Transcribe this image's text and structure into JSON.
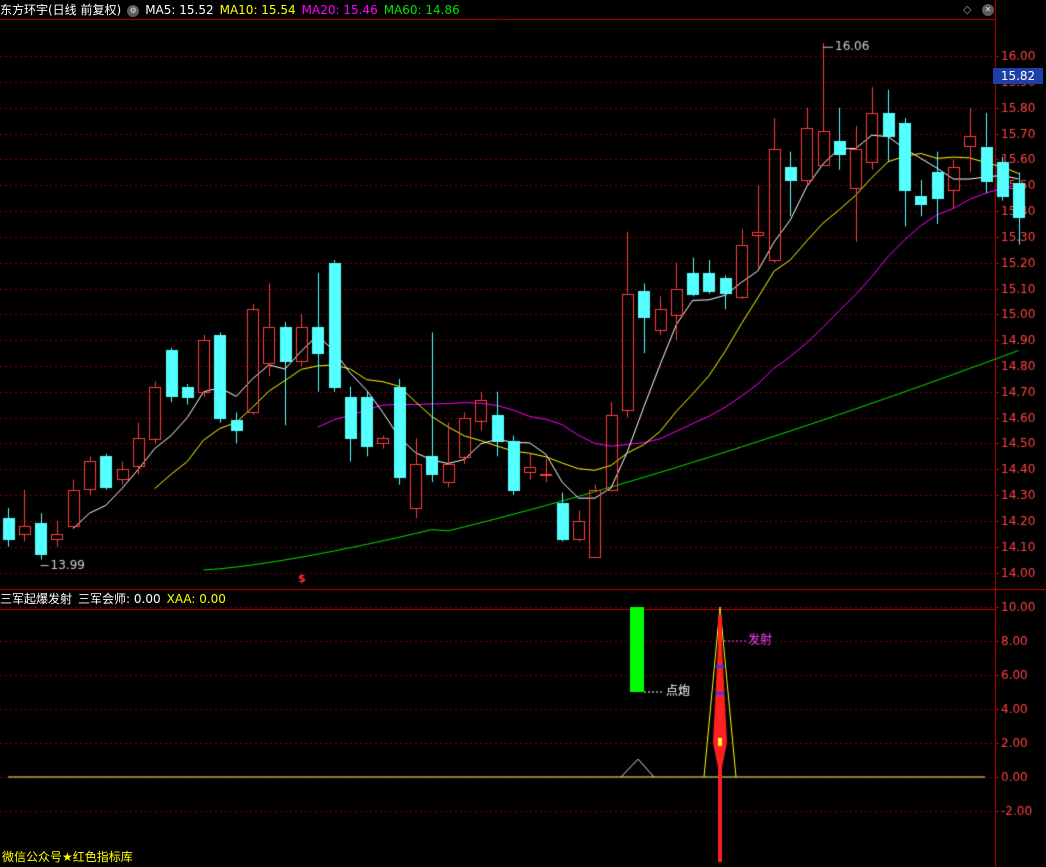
{
  "colors": {
    "up": "#ff3c3c",
    "down": "#54ffff",
    "ma5": "#ffffff",
    "ma10": "#ffff00",
    "ma20": "#ff00ff",
    "ma60": "#00e000",
    "grid": "#7a0000",
    "axis": "#c00000",
    "price_box": "#1e3fa5",
    "footer": "#ffff00"
  },
  "header": {
    "title": "东方环宇(日线 前复权)",
    "ma5_label": "MA5: 15.52",
    "ma10_label": "MA10: 15.54",
    "ma20_label": "MA20: 15.46",
    "ma60_label": "MA60: 14.86"
  },
  "price_panel": {
    "ylim": [
      13.94,
      16.14
    ],
    "ticks": [
      "14.00",
      "14.10",
      "14.20",
      "14.30",
      "14.40",
      "14.50",
      "14.60",
      "14.70",
      "14.80",
      "14.90",
      "15.00",
      "15.10",
      "15.20",
      "15.30",
      "15.40",
      "15.50",
      "15.60",
      "15.70",
      "15.80",
      "15.90",
      "16.00"
    ],
    "current_price": "15.82",
    "high_label": "16.06",
    "low_label": "13.99",
    "marker": "$",
    "candles": [
      [
        14.21,
        14.13,
        14.25,
        14.1
      ],
      [
        14.15,
        14.18,
        14.32,
        14.12
      ],
      [
        14.19,
        14.07,
        14.23,
        14.05
      ],
      [
        14.13,
        14.15,
        14.2,
        14.1
      ],
      [
        14.18,
        14.32,
        14.36,
        14.17
      ],
      [
        14.32,
        14.43,
        14.45,
        14.3
      ],
      [
        14.45,
        14.33,
        14.46,
        14.32
      ],
      [
        14.36,
        14.4,
        14.43,
        14.34
      ],
      [
        14.41,
        14.52,
        14.58,
        14.38
      ],
      [
        14.52,
        14.72,
        14.74,
        14.5
      ],
      [
        14.86,
        14.68,
        14.87,
        14.66
      ],
      [
        14.72,
        14.68,
        14.73,
        14.65
      ],
      [
        14.7,
        14.9,
        14.92,
        14.68
      ],
      [
        14.92,
        14.6,
        14.93,
        14.58
      ],
      [
        14.59,
        14.55,
        14.62,
        14.5
      ],
      [
        14.62,
        15.02,
        15.04,
        14.61
      ],
      [
        14.81,
        14.95,
        15.12,
        14.76
      ],
      [
        14.95,
        14.82,
        14.97,
        14.57
      ],
      [
        14.82,
        14.95,
        15.0,
        14.8
      ],
      [
        14.95,
        14.85,
        15.16,
        14.7
      ],
      [
        15.2,
        14.72,
        15.21,
        14.7
      ],
      [
        14.68,
        14.52,
        14.72,
        14.43
      ],
      [
        14.68,
        14.49,
        14.7,
        14.45
      ],
      [
        14.5,
        14.52,
        14.53,
        14.48
      ],
      [
        14.72,
        14.37,
        14.75,
        14.34
      ],
      [
        14.25,
        14.42,
        14.52,
        14.21
      ],
      [
        14.45,
        14.38,
        14.93,
        14.35
      ],
      [
        14.35,
        14.42,
        14.58,
        14.33
      ],
      [
        14.45,
        14.6,
        14.62,
        14.42
      ],
      [
        14.59,
        14.67,
        14.7,
        14.55
      ],
      [
        14.61,
        14.51,
        14.7,
        14.45
      ],
      [
        14.51,
        14.32,
        14.53,
        14.3
      ],
      [
        14.39,
        14.41,
        14.46,
        14.36
      ],
      [
        14.38,
        14.38,
        14.44,
        14.35
      ],
      [
        14.27,
        14.13,
        14.31,
        14.12
      ],
      [
        14.13,
        14.2,
        14.24,
        14.12
      ],
      [
        14.06,
        14.32,
        14.34,
        14.06
      ],
      [
        14.32,
        14.61,
        14.66,
        14.32
      ],
      [
        14.63,
        15.08,
        15.32,
        14.6
      ],
      [
        15.09,
        14.99,
        15.12,
        14.85
      ],
      [
        14.94,
        15.02,
        15.07,
        14.92
      ],
      [
        15.0,
        15.1,
        15.2,
        14.9
      ],
      [
        15.16,
        15.08,
        15.22,
        15.07
      ],
      [
        15.16,
        15.09,
        15.21,
        15.08
      ],
      [
        15.14,
        15.08,
        15.15,
        15.02
      ],
      [
        15.07,
        15.27,
        15.33,
        15.06
      ],
      [
        15.31,
        15.32,
        15.5,
        15.18
      ],
      [
        15.21,
        15.64,
        15.76,
        15.2
      ],
      [
        15.57,
        15.52,
        15.63,
        15.38
      ],
      [
        15.52,
        15.72,
        15.8,
        15.5
      ],
      [
        15.58,
        15.71,
        16.05,
        15.58
      ],
      [
        15.67,
        15.62,
        15.8,
        15.56
      ],
      [
        15.49,
        15.64,
        15.73,
        15.28
      ],
      [
        15.59,
        15.78,
        15.88,
        15.56
      ],
      [
        15.78,
        15.69,
        15.87,
        15.59
      ],
      [
        15.74,
        15.48,
        15.76,
        15.34
      ],
      [
        15.46,
        15.43,
        15.52,
        15.38
      ],
      [
        15.55,
        15.45,
        15.63,
        15.35
      ],
      [
        15.48,
        15.57,
        15.6,
        15.41
      ],
      [
        15.65,
        15.69,
        15.8,
        15.55
      ],
      [
        15.65,
        15.52,
        15.78,
        15.47
      ],
      [
        15.59,
        15.46,
        15.61,
        15.44
      ],
      [
        15.51,
        15.38,
        15.55,
        15.27
      ]
    ]
  },
  "indicator_panel": {
    "title": "三军起爆发射",
    "value1_label": "三军会师: 0.00",
    "value2_label": "XAA: 0.00",
    "ylim": [
      -5.0,
      11.0
    ],
    "ticks": [
      "10.00",
      "8.00",
      "6.00",
      "4.00",
      "2.00",
      "0.00",
      "-2.00"
    ],
    "label_dianpao": "点炮",
    "label_fashe": "发射"
  },
  "footer": {
    "text": "微信公众号★红色指标库"
  }
}
